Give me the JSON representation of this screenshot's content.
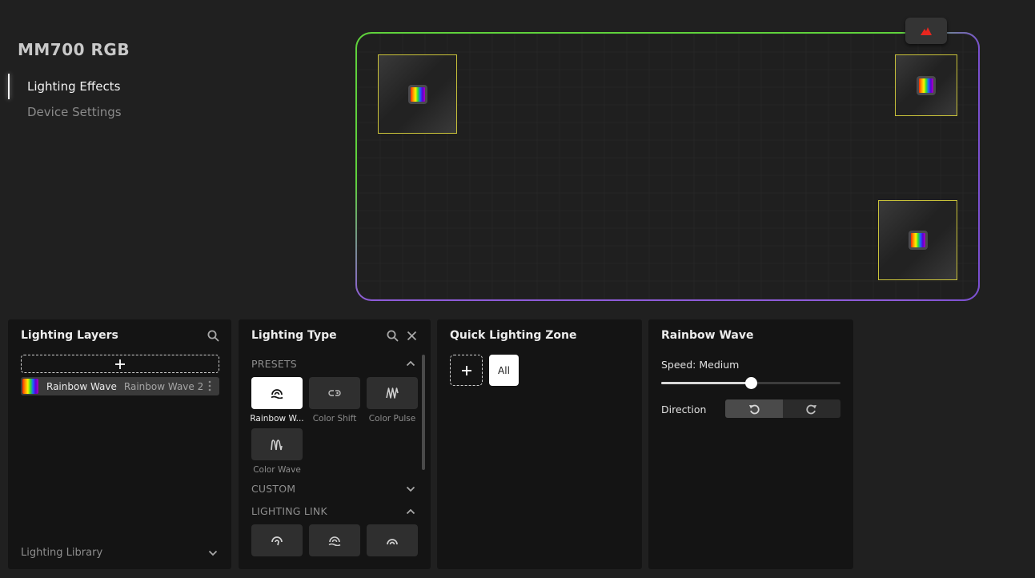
{
  "device": {
    "title": "MM700 RGB"
  },
  "nav": {
    "items": [
      {
        "label": "Lighting Effects",
        "active": true
      },
      {
        "label": "Device Settings",
        "active": false
      }
    ]
  },
  "preview": {
    "edge_colors": {
      "top_left": "#5fd23c",
      "bottom_right": "#8e5bd9"
    },
    "zone_outline_color": "#c9c23a",
    "logo_icon": "corsair-sails-icon",
    "logo_color": "#e8261e",
    "zones": [
      {
        "name": "zone-top-left",
        "effect": "rainbow"
      },
      {
        "name": "zone-top-right",
        "effect": "rainbow"
      },
      {
        "name": "zone-bottom-right",
        "effect": "rainbow"
      }
    ]
  },
  "lighting_layers": {
    "title": "Lighting Layers",
    "search_icon": "search-icon",
    "add_icon": "plus-icon",
    "layers": [
      {
        "name": "Rainbow Wave",
        "subtitle": "Rainbow Wave 2",
        "menu_icon": "more-vertical-icon"
      }
    ],
    "library_label": "Lighting Library",
    "library_icon": "chevron-down-icon"
  },
  "lighting_type": {
    "title": "Lighting Type",
    "search_icon": "search-icon",
    "close_icon": "close-icon",
    "sections": {
      "presets": {
        "label": "PRESETS",
        "expanded": true,
        "items": [
          {
            "label": "Rainbow W...",
            "icon": "rainbow-wave-icon",
            "selected": true
          },
          {
            "label": "Color Shift",
            "icon": "color-shift-icon",
            "selected": false
          },
          {
            "label": "Color Pulse",
            "icon": "color-pulse-icon",
            "selected": false
          },
          {
            "label": "Color Wave",
            "icon": "color-wave-icon",
            "selected": false
          }
        ]
      },
      "custom": {
        "label": "CUSTOM",
        "expanded": false
      },
      "lighting_link": {
        "label": "LIGHTING LINK",
        "expanded": true,
        "items": [
          {
            "icon": "spiral-icon"
          },
          {
            "icon": "rainbow-wave-icon"
          },
          {
            "icon": "rainbow-arc-icon"
          }
        ]
      }
    }
  },
  "quick_zone": {
    "title": "Quick Lighting Zone",
    "add_icon": "plus-icon",
    "all_label": "All"
  },
  "effect_settings": {
    "title": "Rainbow Wave",
    "speed_label": "Speed: Medium",
    "speed_fraction": 0.5,
    "direction_label": "Direction",
    "direction_options": [
      {
        "icon": "rotate-counterclockwise-icon",
        "active": true
      },
      {
        "icon": "rotate-clockwise-icon",
        "active": false
      }
    ]
  }
}
